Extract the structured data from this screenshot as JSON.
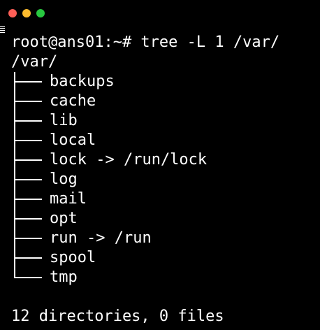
{
  "window": {
    "traffic_lights": {
      "close_color": "#ff5f57",
      "minimize_color": "#febc2e",
      "maximize_color": "#28c840"
    }
  },
  "terminal": {
    "prompt": "root@ans01:~#",
    "command": "tree -L 1 /var/",
    "command_line": "root@ans01:~# tree -L 1 /var/",
    "root_dir": "/var/",
    "entries": [
      {
        "text": "backups"
      },
      {
        "text": "cache"
      },
      {
        "text": "lib"
      },
      {
        "text": "local"
      },
      {
        "text": "lock -> /run/lock"
      },
      {
        "text": "log"
      },
      {
        "text": "mail"
      },
      {
        "text": "opt"
      },
      {
        "text": "run -> /run"
      },
      {
        "text": "spool"
      },
      {
        "text": "tmp"
      }
    ],
    "summary": "12 directories, 0 files"
  }
}
